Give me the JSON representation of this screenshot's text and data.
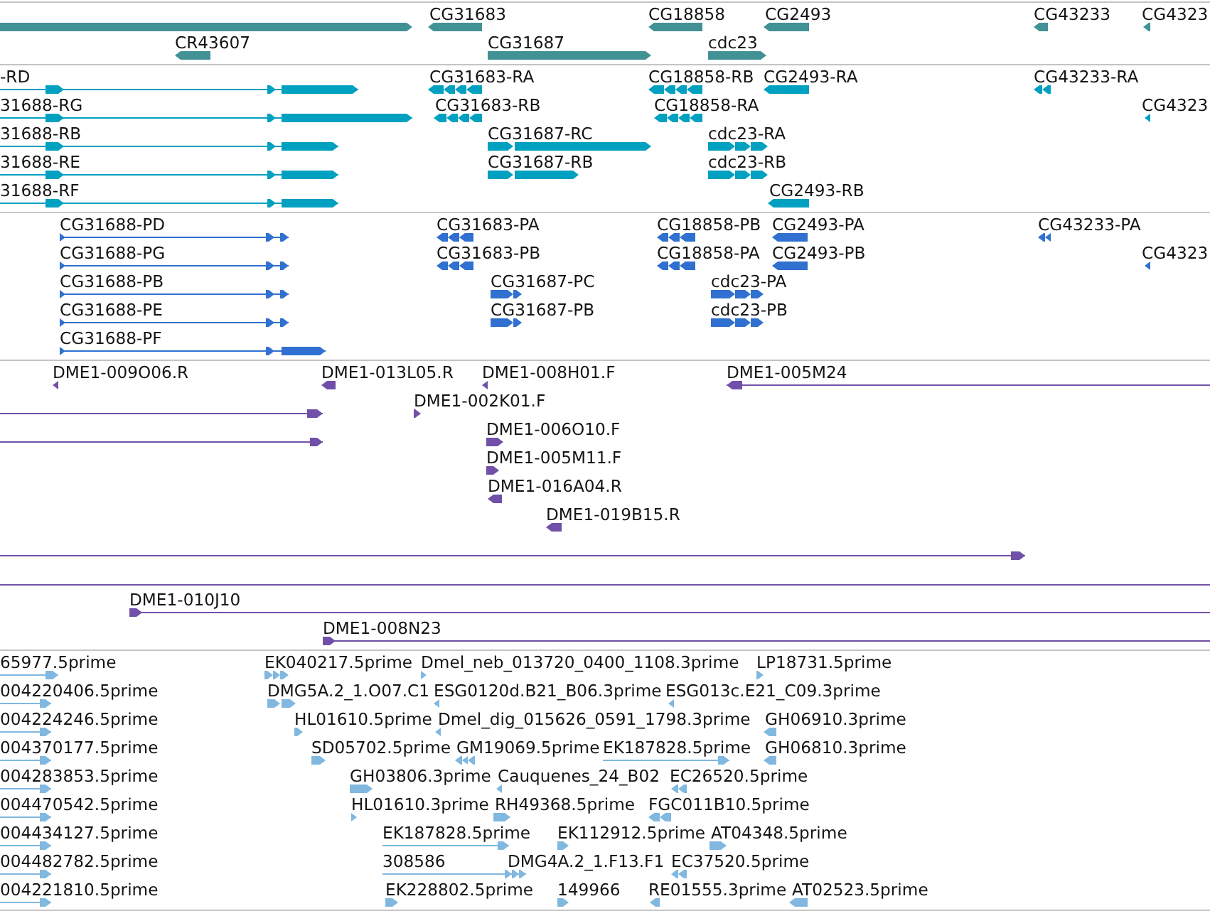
{
  "tracks": [
    {
      "color": "#429194",
      "features": [
        {
          "reverse": false
        },
        {
          "label": "CG31683",
          "reverse": true
        },
        {
          "label": "CG18858",
          "reverse": true
        },
        {
          "label": "CG2493",
          "reverse": true
        },
        {
          "label": "CG43233",
          "reverse": true
        },
        {
          "label": "CG4323",
          "reverse": true
        },
        {
          "label": "CR43607",
          "reverse": true
        },
        {
          "label": "CG31687",
          "reverse": false
        },
        {
          "label": "cdc23",
          "reverse": false
        }
      ]
    },
    {
      "color": "#00a0c0",
      "features": [
        {
          "label": "-RD",
          "reverse": false
        },
        {
          "label": "CG31683-RA",
          "reverse": true
        },
        {
          "label": "CG18858-RB",
          "reverse": true
        },
        {
          "label": "CG2493-RA",
          "reverse": true
        },
        {
          "label": "CG43233-RA",
          "reverse": true
        },
        {
          "label": "31688-RG",
          "reverse": false
        },
        {
          "label": "CG31683-RB",
          "reverse": true
        },
        {
          "label": "CG18858-RA",
          "reverse": true
        },
        {
          "label": "CG4323",
          "reverse": true
        },
        {
          "label": "31688-RB",
          "reverse": false
        },
        {
          "label": "CG31687-RC",
          "reverse": false
        },
        {
          "label": "cdc23-RA",
          "reverse": false
        },
        {
          "label": "31688-RE",
          "reverse": false
        },
        {
          "label": "CG31687-RB",
          "reverse": false
        },
        {
          "label": "cdc23-RB",
          "reverse": false
        },
        {
          "label": "31688-RF",
          "reverse": false
        },
        {
          "label": "CG2493-RB",
          "reverse": true
        }
      ]
    },
    {
      "color": "#3070d0",
      "features": [
        {
          "label": "CG31688-PD",
          "reverse": false
        },
        {
          "label": "CG31683-PA",
          "reverse": true
        },
        {
          "label": "CG18858-PB",
          "reverse": true
        },
        {
          "label": "CG2493-PA",
          "reverse": true
        },
        {
          "label": "CG43233-PA",
          "reverse": true
        },
        {
          "label": "CG31688-PG",
          "reverse": false
        },
        {
          "label": "CG31683-PB",
          "reverse": true
        },
        {
          "label": "CG18858-PA",
          "reverse": true
        },
        {
          "label": "CG2493-PB",
          "reverse": true
        },
        {
          "label": "CG4323",
          "reverse": true
        },
        {
          "label": "CG31688-PB",
          "reverse": false
        },
        {
          "label": "CG31687-PC",
          "reverse": false
        },
        {
          "label": "cdc23-PA",
          "reverse": false
        },
        {
          "label": "CG31688-PE",
          "reverse": false
        },
        {
          "label": "CG31687-PB",
          "reverse": false
        },
        {
          "label": "cdc23-PB",
          "reverse": false
        },
        {
          "label": "CG31688-PF",
          "reverse": false
        }
      ]
    },
    {
      "color": "#7050a8",
      "features": [
        {
          "kind": "arrow",
          "label": "DME1-009O06.R",
          "reverse": true
        },
        {
          "kind": "arrow",
          "label": "DME1-013L05.R",
          "reverse": true
        },
        {
          "kind": "arrow",
          "label": "DME1-008H01.F",
          "reverse": true
        },
        {
          "kind": "arrow",
          "label": "DME1-005M24",
          "reverse": true
        },
        {
          "kind": "arrow",
          "reverse": false
        },
        {
          "kind": "arrow",
          "label": "DME1-002K01.F",
          "reverse": false
        },
        {
          "kind": "arrow",
          "reverse": false
        },
        {
          "kind": "arrow",
          "label": "DME1-006O10.F",
          "reverse": false
        },
        {
          "kind": "arrow",
          "label": "DME1-005M11.F",
          "reverse": false
        },
        {
          "kind": "arrow",
          "label": "DME1-016A04.R",
          "reverse": true
        },
        {
          "kind": "arrow",
          "label": "DME1-019B15.R",
          "reverse": true
        },
        {
          "kind": "arrow",
          "reverse": false
        },
        {
          "kind": "line"
        },
        {
          "kind": "arrow",
          "label": "DME1-010J10",
          "reverse": false
        },
        {
          "kind": "arrow",
          "label": "DME1-008N23",
          "reverse": false
        }
      ]
    },
    {
      "color": "#80b8e0",
      "features": [
        {
          "label": "65977.5prime",
          "reverse": false
        },
        {
          "label": "EK040217.5prime",
          "reverse": false
        },
        {
          "label": "Dmel_neb_013720_0400_1108.3prime",
          "reverse": false
        },
        {
          "label": "LP18731.5prime",
          "reverse": false
        },
        {
          "label": "004220406.5prime",
          "reverse": false
        },
        {
          "label": "DMG5A.2_1.O07.C1",
          "reverse": false
        },
        {
          "label": "ESG0120d.B21_B06.3prime",
          "reverse": true
        },
        {
          "label": "ESG013c.E21_C09.3prime",
          "reverse": true
        },
        {
          "label": "004224246.5prime",
          "reverse": false
        },
        {
          "label": "HL01610.5prime",
          "reverse": false
        },
        {
          "label": "Dmel_dig_015626_0591_1798.3prime",
          "reverse": true
        },
        {
          "label": "GH06910.3prime",
          "reverse": true
        },
        {
          "label": "004370177.5prime",
          "reverse": false
        },
        {
          "label": "SD05702.5prime",
          "reverse": false
        },
        {
          "label": "GM19069.5prime",
          "reverse": true
        },
        {
          "label": "EK187828.5prime",
          "reverse": false
        },
        {
          "label": "GH06810.3prime",
          "reverse": true
        },
        {
          "label": "004283853.5prime",
          "reverse": false
        },
        {
          "label": "GH03806.3prime",
          "reverse": false
        },
        {
          "label": "Cauquenes_24_B02",
          "reverse": true
        },
        {
          "label": "EC26520.5prime",
          "reverse": true
        },
        {
          "label": "004470542.5prime",
          "reverse": false
        },
        {
          "label": "HL01610.3prime",
          "reverse": false
        },
        {
          "label": "RH49368.5prime",
          "reverse": false
        },
        {
          "label": "FGC011B10.5prime",
          "reverse": true
        },
        {
          "label": "004434127.5prime",
          "reverse": false
        },
        {
          "label": "EK187828.5prime",
          "reverse": false
        },
        {
          "label": "EK112912.5prime",
          "reverse": false
        },
        {
          "label": "AT04348.5prime",
          "reverse": false
        },
        {
          "label": "004482782.5prime",
          "reverse": false
        },
        {
          "label": "308586",
          "reverse": false
        },
        {
          "label": "DMG4A.2_1.F13.F1"
        },
        {
          "label": "EC37520.5prime",
          "reverse": true
        },
        {
          "label": "004221810.5prime",
          "reverse": false
        },
        {
          "label": "EK228802.5prime",
          "reverse": false
        },
        {
          "label": "149966",
          "reverse": false
        },
        {
          "label": "RE01555.3prime",
          "reverse": true
        },
        {
          "label": "AT02523.5prime",
          "reverse": true
        }
      ]
    }
  ]
}
